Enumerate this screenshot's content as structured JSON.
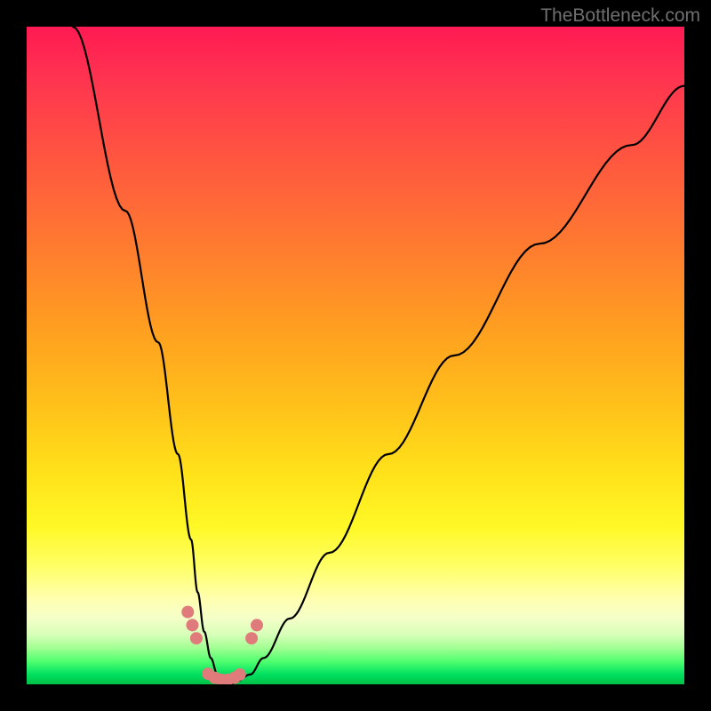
{
  "watermark": "TheBottleneck.com",
  "colors": {
    "page_bg": "#000000",
    "curve_stroke": "#000000",
    "dot_fill": "#e07b7b",
    "gradient_stops": [
      "#ff1a53",
      "#ff3450",
      "#ff5640",
      "#ff7a30",
      "#ff9f20",
      "#ffc21a",
      "#ffe21a",
      "#fff826",
      "#ffff66",
      "#ffffb0",
      "#f4ffc8",
      "#d6ffb8",
      "#a0ff92",
      "#50ff70",
      "#00e060",
      "#00c046"
    ]
  },
  "chart_data": {
    "type": "line",
    "title": "",
    "xlabel": "",
    "ylabel": "",
    "xlim": [
      0,
      100
    ],
    "ylim": [
      0,
      100
    ],
    "series": [
      {
        "name": "bottleneck-curve",
        "x": [
          7,
          15,
          20,
          23,
          25,
          26,
          27,
          28,
          29,
          30,
          31,
          32,
          34,
          36,
          40,
          46,
          55,
          65,
          78,
          92,
          100
        ],
        "y": [
          100,
          72,
          52,
          35,
          22,
          14,
          8,
          4,
          1.5,
          0,
          0,
          0.5,
          1.5,
          4,
          10,
          20,
          35,
          50,
          67,
          82,
          91
        ]
      }
    ],
    "markers": {
      "name": "threshold-dots",
      "x": [
        24.5,
        25.2,
        25.8,
        27.6,
        28.6,
        29.6,
        30.6,
        31.6,
        32.4,
        34.2,
        35.0
      ],
      "y": [
        11,
        9,
        7,
        1.6,
        1.0,
        0.7,
        0.7,
        1.0,
        1.5,
        7,
        9
      ]
    }
  }
}
